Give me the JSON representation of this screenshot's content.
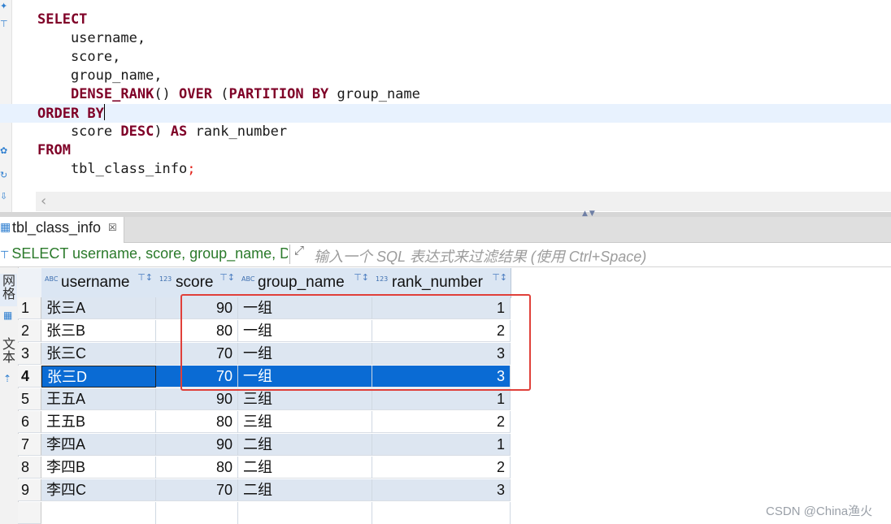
{
  "editor": {
    "lines": [
      {
        "parts": [
          {
            "t": "SELECT",
            "k": "kw"
          }
        ]
      },
      {
        "parts": [
          {
            "t": "    username,",
            "k": ""
          }
        ]
      },
      {
        "parts": [
          {
            "t": "    score,",
            "k": ""
          }
        ]
      },
      {
        "parts": [
          {
            "t": "    group_name,",
            "k": ""
          }
        ]
      },
      {
        "parts": [
          {
            "t": "    ",
            "k": ""
          },
          {
            "t": "DENSE_RANK",
            "k": "kw"
          },
          {
            "t": "() ",
            "k": ""
          },
          {
            "t": "OVER",
            "k": "kw"
          },
          {
            "t": " (",
            "k": ""
          },
          {
            "t": "PARTITION BY",
            "k": "kw"
          },
          {
            "t": " group_name",
            "k": ""
          }
        ]
      },
      {
        "parts": [
          {
            "t": "ORDER BY",
            "k": "kw"
          }
        ],
        "current": true
      },
      {
        "parts": [
          {
            "t": "    score ",
            "k": ""
          },
          {
            "t": "DESC",
            "k": "kw"
          },
          {
            "t": ") ",
            "k": ""
          },
          {
            "t": "AS",
            "k": "kw"
          },
          {
            "t": " rank_number",
            "k": ""
          }
        ]
      },
      {
        "parts": [
          {
            "t": "FROM",
            "k": "kw"
          }
        ]
      },
      {
        "parts": [
          {
            "t": "    tbl_class_info",
            "k": ""
          },
          {
            "t": ";",
            "k": "semi"
          }
        ]
      }
    ]
  },
  "results_tab": {
    "label": "tbl_class_info",
    "close_icon": "close-icon"
  },
  "filter": {
    "query_text": "SELECT username, score, group_name, D",
    "placeholder": "输入一个 SQL 表达式来过滤结果 (使用 Ctrl+Space)"
  },
  "side_tabs": {
    "grid_label": "网格",
    "text_label": "文本"
  },
  "grid": {
    "columns": [
      {
        "name": "username",
        "type_badge": "ABC"
      },
      {
        "name": "score",
        "type_badge": "123"
      },
      {
        "name": "group_name",
        "type_badge": "ABC"
      },
      {
        "name": "rank_number",
        "type_badge": "123"
      }
    ],
    "rows": [
      {
        "n": "1",
        "username": "张三A",
        "score": "90",
        "group_name": "一组",
        "rank_number": "1"
      },
      {
        "n": "2",
        "username": "张三B",
        "score": "80",
        "group_name": "一组",
        "rank_number": "2"
      },
      {
        "n": "3",
        "username": "张三C",
        "score": "70",
        "group_name": "一组",
        "rank_number": "3"
      },
      {
        "n": "4",
        "username": "张三D",
        "score": "70",
        "group_name": "一组",
        "rank_number": "3",
        "selected": true
      },
      {
        "n": "5",
        "username": "王五A",
        "score": "90",
        "group_name": "三组",
        "rank_number": "1"
      },
      {
        "n": "6",
        "username": "王五B",
        "score": "80",
        "group_name": "三组",
        "rank_number": "2"
      },
      {
        "n": "7",
        "username": "李四A",
        "score": "90",
        "group_name": "二组",
        "rank_number": "1"
      },
      {
        "n": "8",
        "username": "李四B",
        "score": "80",
        "group_name": "二组",
        "rank_number": "2"
      },
      {
        "n": "9",
        "username": "李四C",
        "score": "70",
        "group_name": "二组",
        "rank_number": "3"
      }
    ]
  },
  "watermark": "CSDN @China渔火",
  "colors": {
    "keyword": "#7f0027",
    "selection": "#0a6bd4",
    "highlight_box": "#e0403a",
    "filter_query": "#2b7a2b"
  }
}
